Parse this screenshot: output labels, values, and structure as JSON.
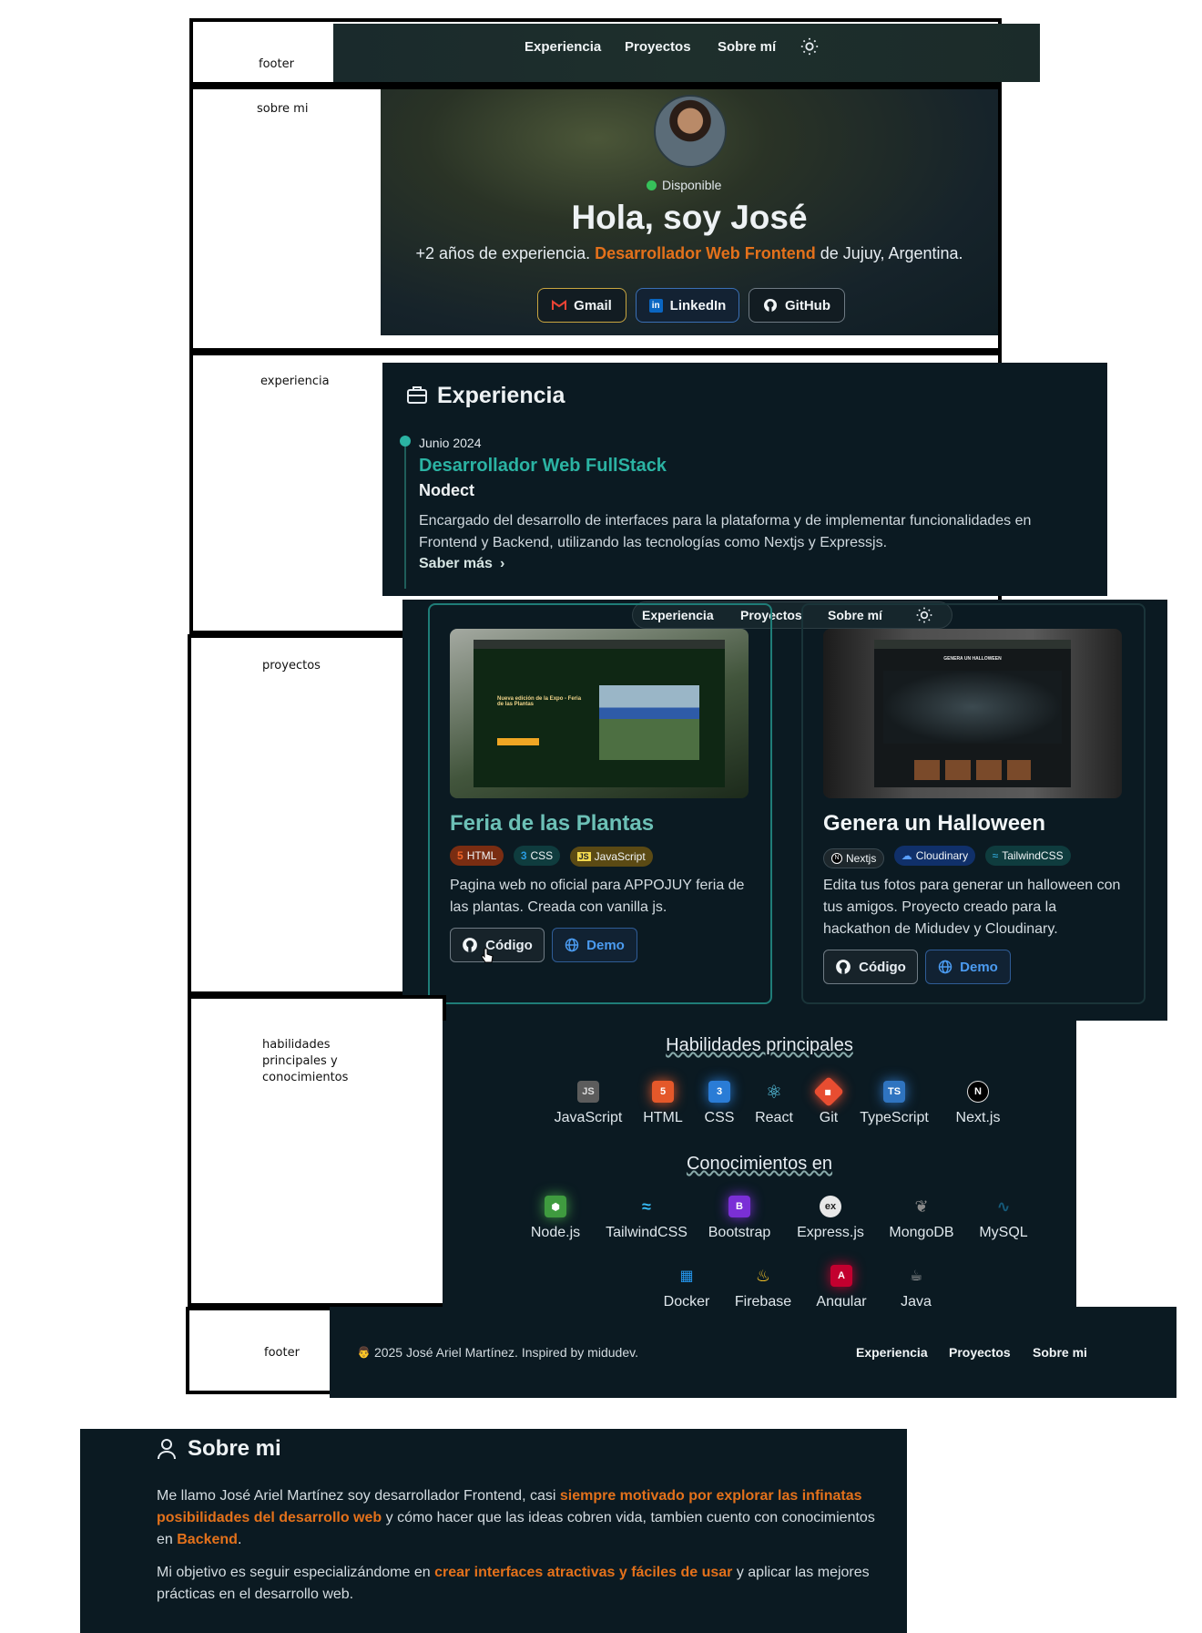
{
  "labels": {
    "footer_top": "footer",
    "sobre_mi": "sobre mi",
    "experiencia": "experiencia",
    "proyectos": "proyectos",
    "habilidades": "habilidades principales y conocimientos",
    "footer_bottom": "footer"
  },
  "nav": {
    "items": [
      "Experiencia",
      "Proyectos",
      "Sobre mí"
    ],
    "theme_icon": "sun-icon"
  },
  "hero": {
    "status": "Disponible",
    "title": "Hola, soy José",
    "subtitle_prefix": "+2 años de experiencia. ",
    "subtitle_highlight": "Desarrollador Web Frontend",
    "subtitle_suffix": " de Jujuy, Argentina.",
    "buttons": [
      {
        "label": "Gmail",
        "icon": "gmail-icon"
      },
      {
        "label": "LinkedIn",
        "icon": "linkedin-icon"
      },
      {
        "label": "GitHub",
        "icon": "github-icon"
      }
    ]
  },
  "experience": {
    "heading": "Experiencia",
    "date": "Junio 2024",
    "role": "Desarrollador Web FullStack",
    "company": "Nodect",
    "description": "Encargado del desarrollo de interfaces para la plataforma y de implementar funcionalidades en Frontend y Backend, utilizando las tecnologías como Nextjs y Expressjs.",
    "more": "Saber más"
  },
  "projects": [
    {
      "title": "Feria de las Plantas",
      "tags": [
        "HTML",
        "CSS",
        "JavaScript"
      ],
      "description": "Pagina web no oficial para APPOJUY feria de las plantas. Creada con vanilla js.",
      "code_label": "Código",
      "demo_label": "Demo",
      "preview_heading": "Nueva edición de la Expo - Feria de las Plantas"
    },
    {
      "title": "Genera un Halloween",
      "tags": [
        "Nextjs",
        "Cloudinary",
        "TailwindCSS"
      ],
      "description": "Edita tus fotos para generar un halloween con tus amigos. Proyecto creado para la hackathon de Midudev y Cloudinary.",
      "code_label": "Código",
      "demo_label": "Demo",
      "preview_heading": "GENERA UN HALLOWEEN"
    }
  ],
  "skills": {
    "heading": "Habilidades principales",
    "items": [
      "JavaScript",
      "HTML",
      "CSS",
      "React",
      "Git",
      "TypeScript",
      "Next.js"
    ],
    "knowledge_heading": "Conocimientos en",
    "knowledge": [
      "Node.js",
      "TailwindCSS",
      "Bootstrap",
      "Express.js",
      "MongoDB",
      "MySQL"
    ],
    "knowledge_row2": [
      "Docker",
      "Firebase",
      "Angular",
      "Java"
    ]
  },
  "footer": {
    "copyright": "2025 José Ariel Martínez. Inspired by midudev.",
    "links": [
      "Experiencia",
      "Proyectos",
      "Sobre mi"
    ]
  },
  "about": {
    "heading": "Sobre mi",
    "p1_a": "Me llamo José Ariel Martínez soy desarrollador Frontend, casi ",
    "p1_h1": "siempre motivado por explorar las infinatas posibilidades del desarrollo web",
    "p1_b": " y cómo hacer que las ideas cobren vida, tambien cuento con conocimientos en ",
    "p1_h2": "Backend",
    "p1_c": ".",
    "p2_a": "Mi objetivo es seguir especializándome en ",
    "p2_h": "crear interfaces atractivas y fáciles de usar",
    "p2_b": " y aplicar las mejores prácticas en el desarrollo web."
  },
  "colors": {
    "accent_orange": "#e3711b",
    "accent_teal": "#2bb3a3",
    "bg_dark": "#0b1a22"
  }
}
